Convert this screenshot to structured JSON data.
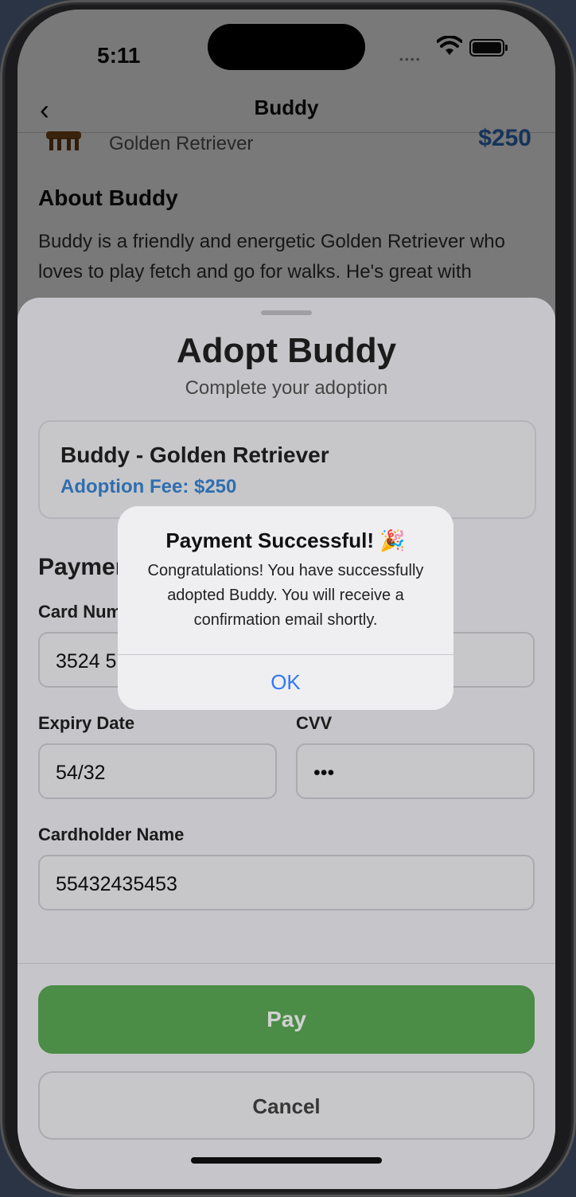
{
  "status_bar": {
    "time": "5:11"
  },
  "nav": {
    "title": "Buddy"
  },
  "background": {
    "breed": "Golden Retriever",
    "price": "$250",
    "about_heading": "About Buddy",
    "about_text": "Buddy is a friendly and energetic Golden Retriever who loves to play fetch and go for walks. He's great with"
  },
  "sheet": {
    "title": "Adopt Buddy",
    "subtitle": "Complete your adoption",
    "pet_summary": {
      "name": "Buddy - Golden Retriever",
      "fee": "Adoption Fee: $250"
    },
    "payment_heading": "Payment Details",
    "card_number": {
      "label": "Card Number",
      "value": "3524 5"
    },
    "expiry": {
      "label": "Expiry Date",
      "value": "54/32"
    },
    "cvv": {
      "label": "CVV",
      "value": "•••"
    },
    "cardholder": {
      "label": "Cardholder Name",
      "value": "55432435453"
    },
    "pay_label": "Pay",
    "cancel_label": "Cancel"
  },
  "alert": {
    "title": "Payment Successful! 🎉",
    "message": "Congratulations! You have successfully adopted Buddy. You will receive a confirmation email shortly.",
    "ok_label": "OK"
  },
  "colors": {
    "accent_blue": "#3478f6",
    "pay_green": "#5cab56",
    "fee_blue": "#3a87d6"
  }
}
